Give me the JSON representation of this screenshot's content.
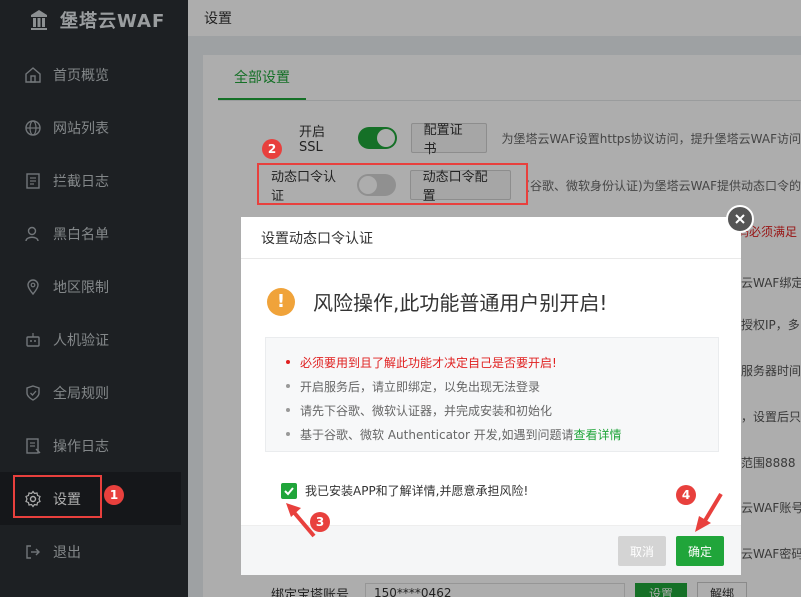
{
  "app": {
    "logo_text": "堡塔云WAF"
  },
  "sidebar": {
    "items": [
      {
        "label": "首页概览",
        "icon": "home-icon"
      },
      {
        "label": "网站列表",
        "icon": "globe-icon"
      },
      {
        "label": "拦截日志",
        "icon": "log-icon"
      },
      {
        "label": "黑白名单",
        "icon": "user-icon"
      },
      {
        "label": "地区限制",
        "icon": "location-icon"
      },
      {
        "label": "人机验证",
        "icon": "robot-icon"
      },
      {
        "label": "全局规则",
        "icon": "shield-icon"
      },
      {
        "label": "操作日志",
        "icon": "oplog-icon"
      },
      {
        "label": "设置",
        "icon": "gear-icon"
      },
      {
        "label": "退出",
        "icon": "logout-icon"
      }
    ],
    "active_index": 8
  },
  "topbar": {
    "title": "设置"
  },
  "tabs": [
    {
      "label": "全部设置"
    }
  ],
  "settings": {
    "ssl": {
      "label": "开启SSL",
      "enabled": true,
      "button": "配置证书",
      "desc": "为堡塔云WAF设置https协议访问，提升堡塔云WAF访问"
    },
    "otp": {
      "label": "动态口令认证",
      "enabled": false,
      "button": "动态口令配置",
      "desc": "(谷歌、微软身份认证)为堡塔云WAF提供动态口令的"
    }
  },
  "background_fragments": [
    {
      "text": "码必须满足",
      "red": true
    },
    {
      "text": "云WAF绑定一",
      "red": false
    },
    {
      "text": "授权IP，多",
      "red": false
    },
    {
      "text": "服务器时间",
      "red": false
    },
    {
      "text": "，设置后只",
      "red": false
    },
    {
      "text": "范围8888",
      "red": false
    },
    {
      "text": "云WAF账号",
      "red": false
    },
    {
      "text": "云WAF密码",
      "red": false
    }
  ],
  "bottom_row": {
    "label": "绑定宝塔账号",
    "value": "150****0462",
    "btn1": "设置",
    "btn2": "解绑"
  },
  "dialog": {
    "title": "设置动态口令认证",
    "warning": "风险操作,此功能普通用户别开启!",
    "notices": [
      {
        "text": "必须要用到且了解此功能才决定自己是否要开启!",
        "red": true
      },
      {
        "text": "开启服务后，请立即绑定，以免出现无法登录",
        "red": false
      },
      {
        "text": "请先下谷歌、微软认证器，并完成安装和初始化",
        "red": false
      },
      {
        "text": "基于谷歌、微软 Authenticator 开发,如遇到问题请",
        "red": false,
        "link": "查看详情"
      }
    ],
    "agree_text": "我已安装APP和了解详情,并愿意承担风险!",
    "agree_checked": true,
    "cancel": "取消",
    "ok": "确定"
  },
  "markers": [
    "1",
    "2",
    "3",
    "4"
  ],
  "colors": {
    "accent": "#20a53a",
    "sidebar_bg": "#2b3034",
    "highlight": "#e8403d",
    "warning": "#f0a33a"
  }
}
